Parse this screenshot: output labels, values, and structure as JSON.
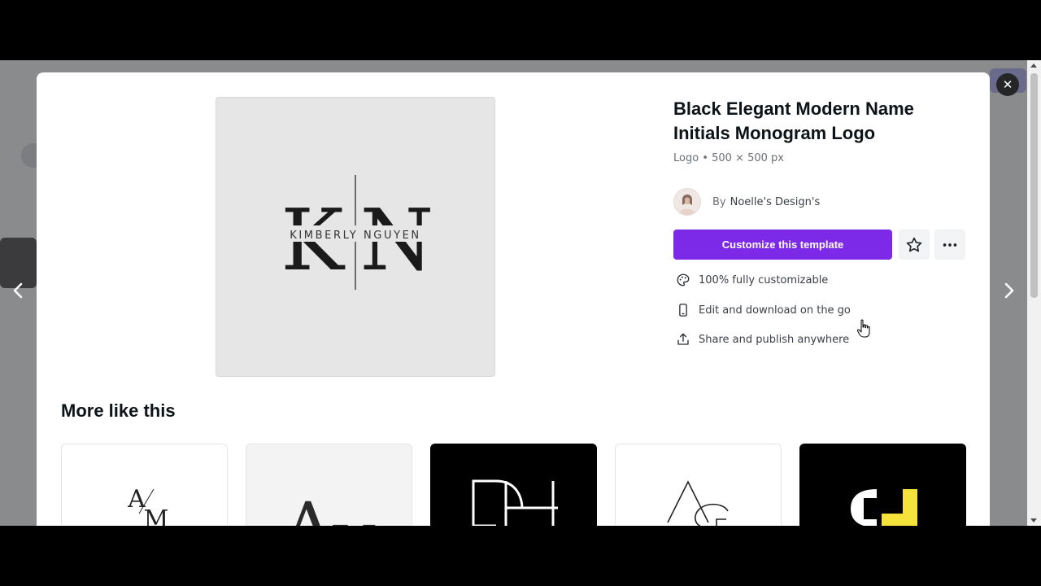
{
  "template": {
    "title": "Black Elegant Modern Name Initials Monogram Logo",
    "meta": "Logo • 500 × 500 px",
    "by_label": "By",
    "author": "Noelle's Design's"
  },
  "preview": {
    "big_letter_left": "K",
    "big_letter_right": "N",
    "name_text": "KIMBERLY NGUYEN"
  },
  "actions": {
    "customize_label": "Customize this template",
    "star_icon": "star-outline-icon",
    "more_icon": "ellipsis-icon",
    "accent_color": "#7d2ae8"
  },
  "features": [
    {
      "icon": "palette-icon",
      "text": "100% fully customizable"
    },
    {
      "icon": "phone-icon",
      "text": "Edit and download on the go"
    },
    {
      "icon": "share-icon",
      "text": "Share and publish anywhere"
    }
  ],
  "more_like_this": {
    "title": "More like this",
    "items": [
      {
        "text": "A/M",
        "theme": "light"
      },
      {
        "text": "AV",
        "theme": "light-gray"
      },
      {
        "text": "DH",
        "theme": "dark"
      },
      {
        "text": "AG",
        "theme": "light"
      },
      {
        "text": "CJ",
        "theme": "dark-yellow"
      }
    ]
  }
}
